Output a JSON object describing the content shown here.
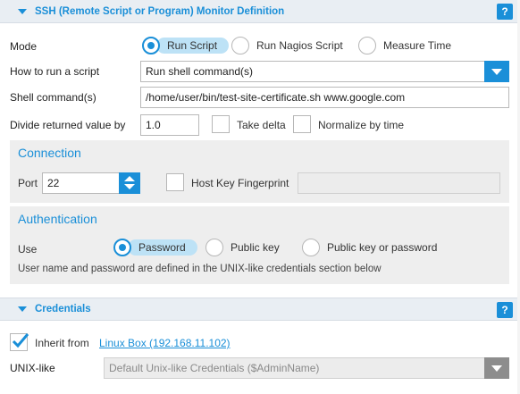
{
  "monitor_section": {
    "title": "SSH (Remote Script or Program) Monitor Definition",
    "help_label": "?"
  },
  "mode": {
    "label": "Mode",
    "options": [
      "Run Script",
      "Run Nagios Script",
      "Measure Time"
    ],
    "selected": "Run Script"
  },
  "how_to_run": {
    "label": "How to run a script",
    "value": "Run shell command(s)"
  },
  "shell_command": {
    "label": "Shell command(s)",
    "value": "/home/user/bin/test-site-certificate.sh www.google.com"
  },
  "divide": {
    "label": "Divide returned value by",
    "value": "1.0",
    "take_delta_label": "Take delta",
    "take_delta_checked": false,
    "normalize_label": "Normalize by time",
    "normalize_checked": false
  },
  "connection": {
    "title": "Connection",
    "port_label": "Port",
    "port_value": "22",
    "host_key_label": "Host Key Fingerprint",
    "host_key_checked": false,
    "host_key_value": ""
  },
  "authentication": {
    "title": "Authentication",
    "use_label": "Use",
    "options": [
      "Password",
      "Public key",
      "Public key or password"
    ],
    "selected": "Password",
    "note": "User name and password are defined in the UNIX-like credentials section below"
  },
  "credentials_section": {
    "title": "Credentials",
    "help_label": "?"
  },
  "credentials": {
    "inherit_label": "Inherit from",
    "inherit_checked": true,
    "inherit_link": "Linux Box (192.168.11.102)",
    "unix_label": "UNIX-like",
    "unix_value": "Default Unix-like Credentials ($AdminName)"
  },
  "colors": {
    "accent": "#1a8fd8",
    "radio_selected_bg": "#bde2f6",
    "panel_bg": "#eeeeee",
    "header_bg": "#e9eef3"
  }
}
